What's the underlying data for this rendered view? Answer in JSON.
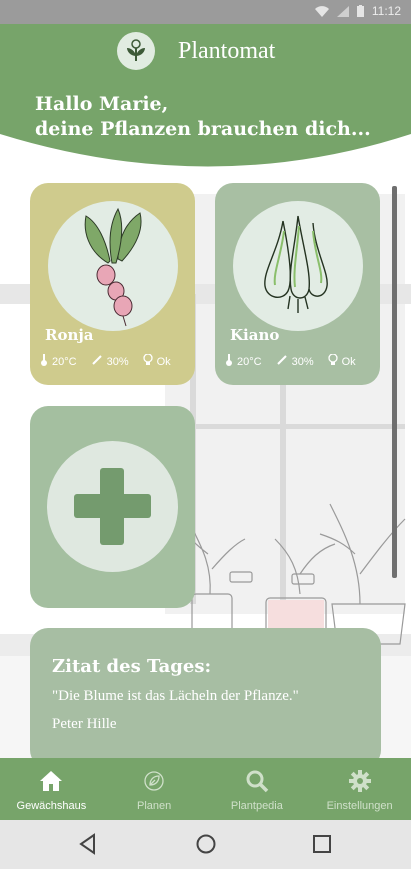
{
  "status_bar": {
    "time": "11:12"
  },
  "header": {
    "app_title": "Plantomat",
    "greeting_line1": "Hallo Marie,",
    "greeting_line2": "deine Pflanzen brauchen dich..."
  },
  "plants": [
    {
      "name": "Ronja",
      "temperature": "20°C",
      "humidity": "30%",
      "light": "Ok"
    },
    {
      "name": "Kiano",
      "temperature": "20°C",
      "humidity": "30%",
      "light": "Ok"
    }
  ],
  "quote": {
    "title": "Zitat des Tages:",
    "text": "\"Die Blume ist das Lächeln der Pflanze.\"",
    "author": "Peter Hille"
  },
  "bottom_nav": [
    {
      "label": "Gewächshaus",
      "icon": "home-icon",
      "active": true
    },
    {
      "label": "Planen",
      "icon": "leaf-icon",
      "active": false
    },
    {
      "label": "Plantpedia",
      "icon": "search-icon",
      "active": false
    },
    {
      "label": "Einstellungen",
      "icon": "gear-icon",
      "active": false
    }
  ],
  "colors": {
    "primary_green": "#77a46a",
    "card_yellow": "#cfcb8d",
    "card_green": "#a8bfa3",
    "status_bar": "#9b9b9b"
  }
}
